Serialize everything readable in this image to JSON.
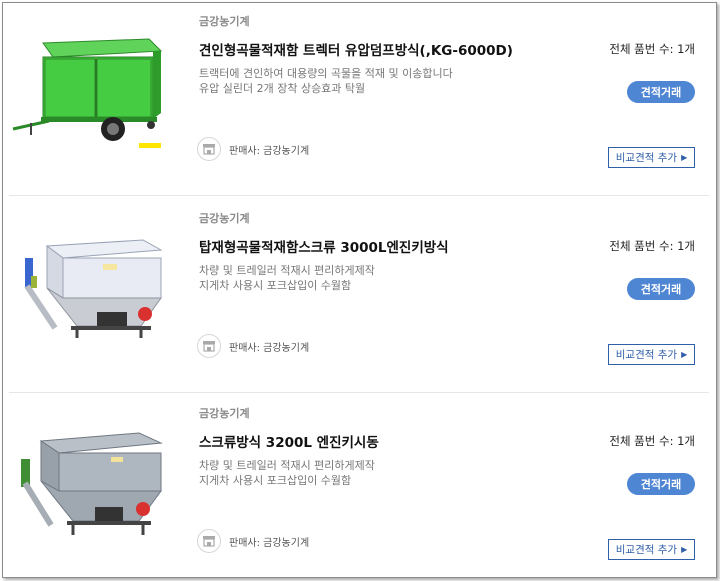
{
  "products": [
    {
      "seller_top": "금강농기계",
      "title": "견인형곡물적재함 트렉터 유압덤프방식(,KG-6000D)",
      "desc_line1": "트랙터에 견인하여 대용량의 곡물을 적재 및 이송합니다",
      "desc_line2": "유압 실린더 2개 장착 상승효과 탁월",
      "seller_label": "판매사: 금강농기계",
      "count": "전체 품번 수: 1개",
      "trade_label": "견적거래",
      "compare_label": "비교견적 추가",
      "image_icon": "green-dump-trailer"
    },
    {
      "seller_top": "금강농기계",
      "title": "탑재형곡물적재함스크류 3000L엔진키방식",
      "desc_line1": "차량 및 트레일러 적재시 편리하게제작",
      "desc_line2": "지게차 사용시 포크삽입이 수월함",
      "seller_label": "판매사: 금강농기계",
      "count": "전체 품번 수: 1개",
      "trade_label": "견적거래",
      "compare_label": "비교견적 추가",
      "image_icon": "grain-hopper-white"
    },
    {
      "seller_top": "금강농기계",
      "title": "스크류방식 3200L 엔진키시동",
      "desc_line1": "차량 및 트레일러 적재시 편리하게제작",
      "desc_line2": "지게차 사용시 포크삽입이 수월함",
      "seller_label": "판매사: 금강농기계",
      "count": "전체 품번 수: 1개",
      "trade_label": "견적거래",
      "compare_label": "비교견적 추가",
      "image_icon": "grain-hopper-galvanized"
    }
  ]
}
